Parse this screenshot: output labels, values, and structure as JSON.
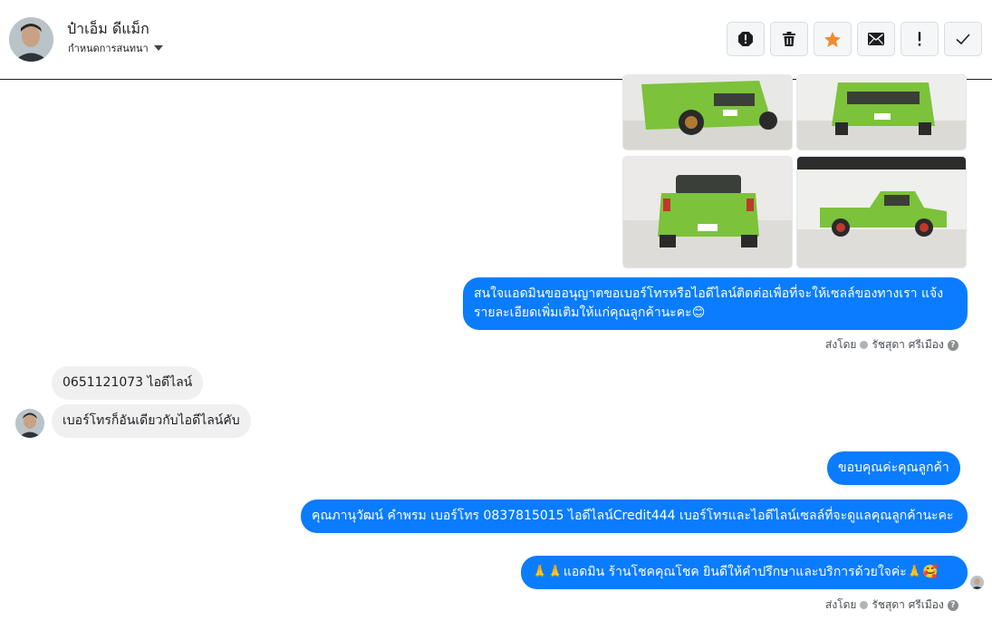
{
  "header": {
    "contact_name": "ป๋าเอ็ม ดีแม็ก",
    "subtitle": "กำหนดการสนทนา",
    "avatar_icon": "user-avatar",
    "actions": [
      {
        "name": "report-icon"
      },
      {
        "name": "trash-icon"
      },
      {
        "name": "star-icon",
        "color": "#f28a2c"
      },
      {
        "name": "mail-icon"
      },
      {
        "name": "exclamation-icon"
      },
      {
        "name": "check-icon"
      }
    ]
  },
  "photos": [
    {
      "name": "truck-front-left-photo"
    },
    {
      "name": "truck-front-photo"
    },
    {
      "name": "truck-rear-photo"
    },
    {
      "name": "truck-side-photo"
    }
  ],
  "messages": [
    {
      "direction": "outgoing",
      "text": "สนใจแอดมินขออนุญาตขอเบอร์โทรหรือไอดีไลน์ติดต่อเพื่อที่จะให้เซลล์ของทางเรา แจ้งรายละเอียดเพิ่มเติมให้แก่คุณลูกค้านะคะ😊"
    },
    {
      "direction": "incoming",
      "text": "0651121073 ไอดีไลน์"
    },
    {
      "direction": "incoming",
      "text": "เบอร์โทรก็อันเดียวกับไอดีไลน์คับ"
    },
    {
      "direction": "outgoing",
      "text": "ขอบคุณค่ะคุณลูกค้า"
    },
    {
      "direction": "outgoing",
      "text": "คุณภานุวัฒน์ คำพรม       เบอร์โทร 0837815015  ไอดีไลน์Credit444  เบอร์โทรและไอดีไลน์เซลล์ที่จะดูแลคุณลูกค้านะคะ"
    },
    {
      "direction": "outgoing",
      "text": "🙏🙏แอดมิน ร้านโชคคุณโชค ยินดีให้คำปรึกษาและบริการด้วยใจค่ะ🙏🥰"
    }
  ],
  "sent_by": [
    {
      "prefix": "ส่งโดย",
      "agent": "รัชสุดา ศรีเมือง",
      "help": "?"
    },
    {
      "prefix": "ส่งโดย",
      "agent": "รัชสุดา ศรีเมือง",
      "help": "?"
    }
  ],
  "colors": {
    "outgoing_bubble": "#0a7cff",
    "incoming_bubble": "#f0f0f0",
    "truck_body": "#7cc23a"
  }
}
